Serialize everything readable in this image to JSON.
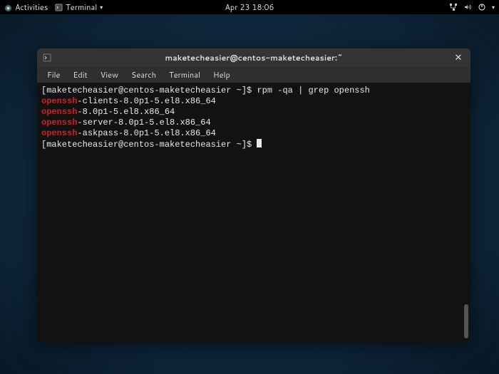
{
  "panel": {
    "activities": "Activities",
    "app_label": "Terminal",
    "clock": "Apr 23  18:06"
  },
  "window": {
    "title": "maketecheasier@centos-maketecheasier:~"
  },
  "menu": {
    "file": "File",
    "edit": "Edit",
    "view": "View",
    "search": "Search",
    "terminal": "Terminal",
    "help": "Help"
  },
  "term": {
    "prompt1": "[maketecheasier@centos-maketecheasier ~]$ ",
    "cmd1": "rpm -qa | grep openssh",
    "hl": "openssh",
    "out1_rest": "-clients-8.0p1-5.el8.x86_64",
    "out2_rest": "-8.0p1-5.el8.x86_64",
    "out3_rest": "-server-8.0p1-5.el8.x86_64",
    "out4_rest": "-askpass-8.0p1-5.el8.x86_64",
    "prompt2": "[maketecheasier@centos-maketecheasier ~]$ "
  }
}
